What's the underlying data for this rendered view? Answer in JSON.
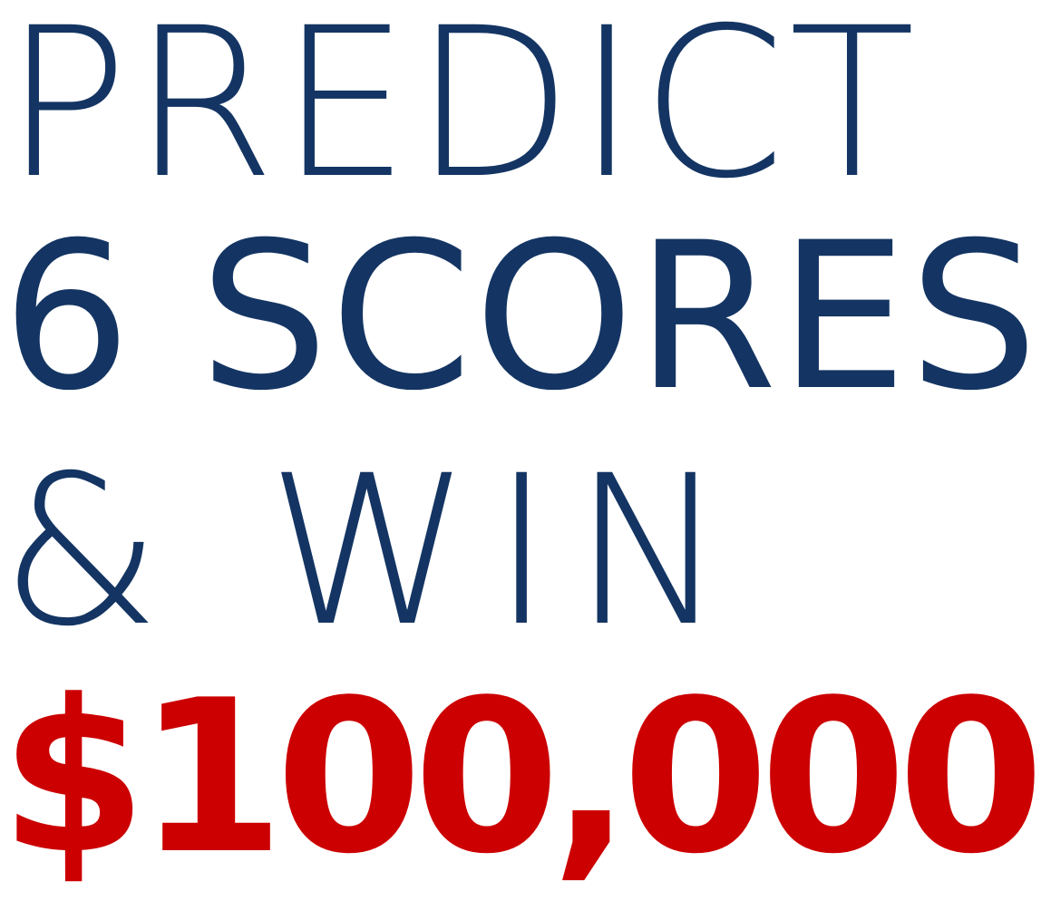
{
  "headline": {
    "line1": "PREDICT",
    "line2": "6 SCORES",
    "line3": "& WIN",
    "prize": "$100,000"
  },
  "colors": {
    "navy": "#143563",
    "red": "#cc0000",
    "background": "#ffffff"
  }
}
